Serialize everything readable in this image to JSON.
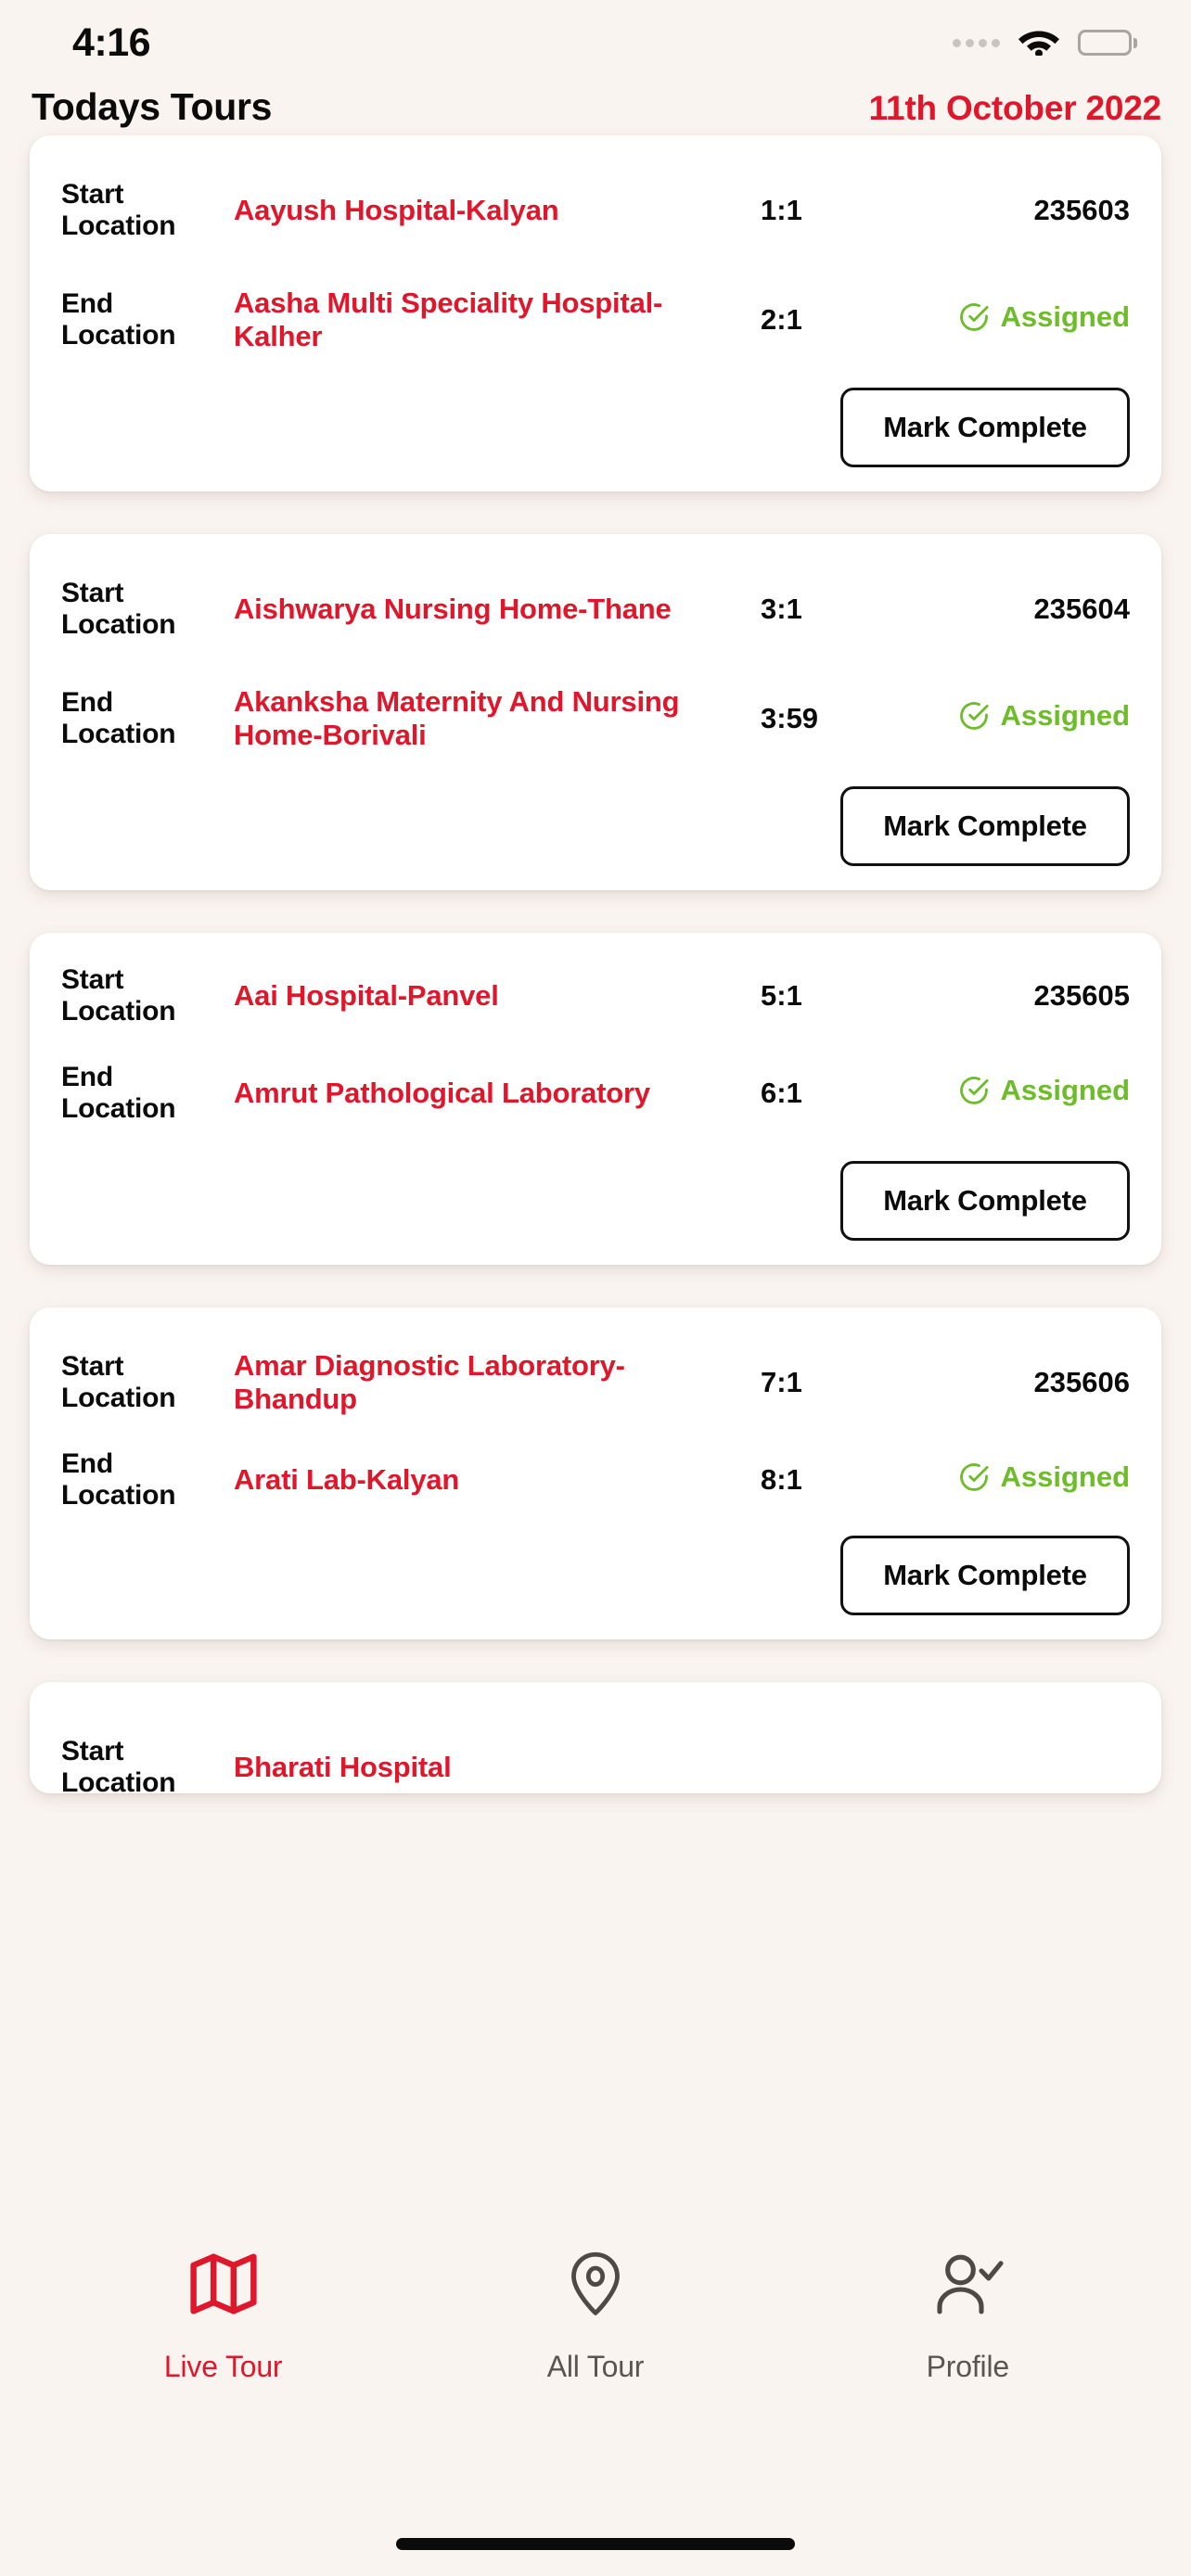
{
  "status_bar": {
    "time": "4:16",
    "icons": [
      "signal-dots-icon",
      "wifi-icon",
      "battery-icon"
    ]
  },
  "header": {
    "title": "Todays Tours",
    "date": "11th October 2022"
  },
  "labels": {
    "start_location": "Start Location",
    "end_location": "End Location",
    "mark_complete": "Mark Complete",
    "assigned": "Assigned"
  },
  "colors": {
    "background": "#faf4f0",
    "card": "#ffffff",
    "accent_red": "#e0162b",
    "status_green": "#6cbd27",
    "text_dark": "#0b0b0b",
    "nav_inactive": "#5a5550"
  },
  "tours": [
    {
      "start_label": "Start Location",
      "start_place": "Aayush Hospital-Kalyan",
      "start_time": "1:1",
      "tour_id": "235603",
      "end_label": "End Location",
      "end_place": "Aasha Multi Speciality Hospital-Kalher",
      "end_time": "2:1",
      "status": "Assigned",
      "action": "Mark Complete"
    },
    {
      "start_label": "Start Location",
      "start_place": "Aishwarya Nursing Home-Thane",
      "start_time": "3:1",
      "tour_id": "235604",
      "end_label": "End Location",
      "end_place": "Akanksha Maternity And Nursing Home-Borivali",
      "end_time": "3:59",
      "status": "Assigned",
      "action": "Mark Complete"
    },
    {
      "start_label": "Start Location",
      "start_place": "Aai Hospital-Panvel",
      "start_time": "5:1",
      "tour_id": "235605",
      "end_label": "End Location",
      "end_place": "Amrut Pathological Laboratory",
      "end_time": "6:1",
      "status": "Assigned",
      "action": "Mark Complete"
    },
    {
      "start_label": "Start Location",
      "start_place": "Amar Diagnostic Laboratory-Bhandup",
      "start_time": "7:1",
      "tour_id": "235606",
      "end_label": "End Location",
      "end_place": "Arati Lab-Kalyan",
      "end_time": "8:1",
      "status": "Assigned",
      "action": "Mark Complete"
    }
  ],
  "partial_tour": {
    "start_place": "Bharati Hospital"
  },
  "bottom_nav": {
    "items": [
      {
        "label": "Live Tour",
        "icon": "map-icon",
        "active": true
      },
      {
        "label": "All Tour",
        "icon": "map-pin-icon",
        "active": false
      },
      {
        "label": "Profile",
        "icon": "person-check-icon",
        "active": false
      }
    ]
  }
}
